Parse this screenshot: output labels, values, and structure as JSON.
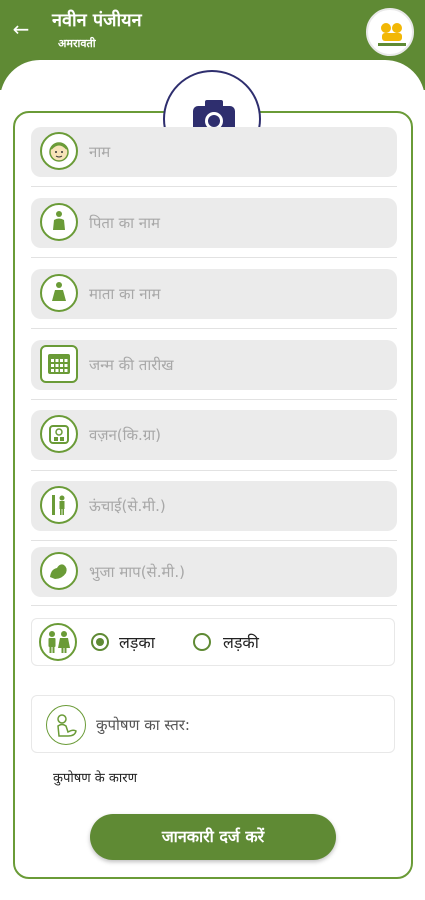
{
  "header": {
    "title": "नवीन पंजीयन",
    "subtitle": "अमरावती",
    "back_icon": "arrow-left-icon",
    "logo_icon": "app-logo-icon"
  },
  "photo": {
    "icon": "camera-icon",
    "edit_icon": "small-camera-icon"
  },
  "fields": [
    {
      "placeholder": "नाम",
      "icon": "child-face-icon"
    },
    {
      "placeholder": "पिता का नाम",
      "icon": "person-icon"
    },
    {
      "placeholder": "माता का नाम",
      "icon": "person-icon"
    },
    {
      "placeholder": "जन्म की तारीख",
      "icon": "calendar-icon"
    },
    {
      "placeholder": "वज़न(कि.ग्रा)",
      "icon": "weighing-scale-icon"
    },
    {
      "placeholder": "ऊंचाई(से.मी.)",
      "icon": "height-measure-icon"
    },
    {
      "placeholder": "भुजा माप(से.मी.)",
      "icon": "arm-icon"
    }
  ],
  "gender": {
    "icon": "gender-icon",
    "options": [
      "लड़का",
      "लड़की"
    ],
    "selected": "लड़का"
  },
  "malnutrition": {
    "label": "कुपोषण का स्तर:",
    "icon": "malnutrition-icon"
  },
  "reason_label": "कुपोषण के कारण",
  "submit_label": "जानकारी दर्ज करें",
  "colors": {
    "primary": "#5f8a34",
    "field_bg": "#ebebeb",
    "camera_accent": "#2e2e6e"
  }
}
